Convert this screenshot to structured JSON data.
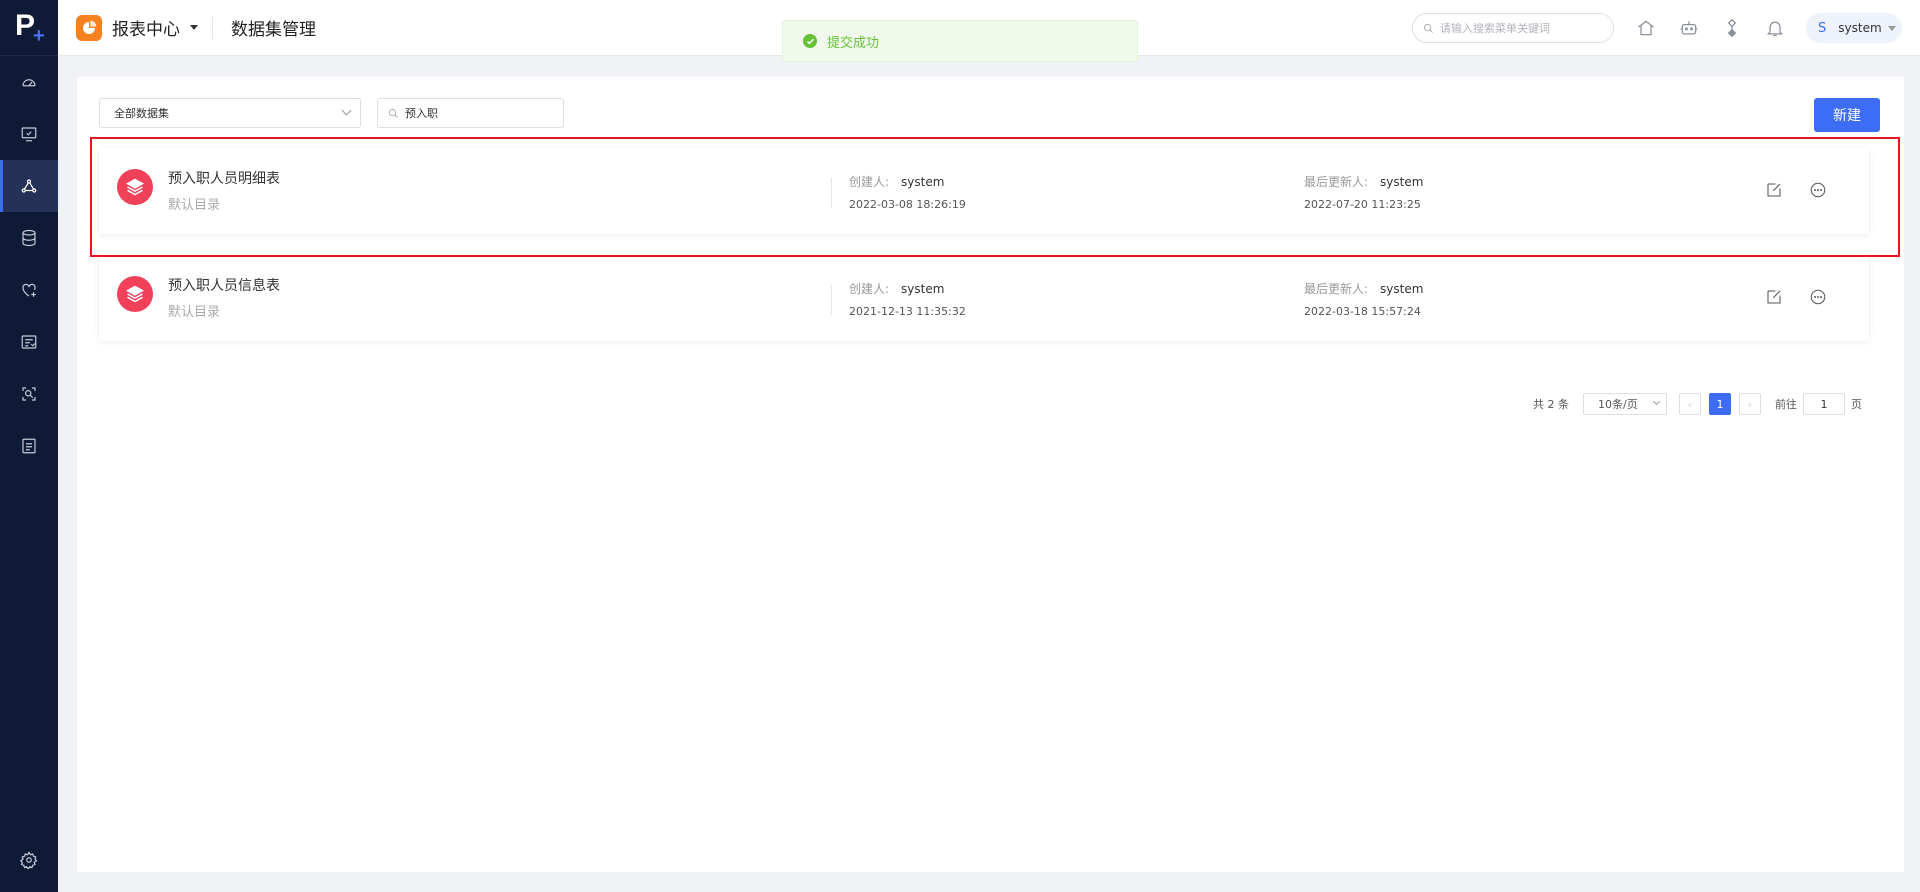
{
  "sidebar": {
    "logo": "P+",
    "items": [
      {
        "name": "dashboard-icon"
      },
      {
        "name": "monitor-icon"
      },
      {
        "name": "dataset-node-icon",
        "active": true
      },
      {
        "name": "database-icon"
      },
      {
        "name": "heart-plus-icon"
      },
      {
        "name": "report-list-icon"
      },
      {
        "name": "search-inspect-icon"
      },
      {
        "name": "form-icon"
      }
    ],
    "bottom": {
      "name": "settings-icon"
    }
  },
  "header": {
    "app_title": "报表中心",
    "page_title": "数据集管理",
    "search_placeholder": "请输入搜索菜单关键词",
    "user_initial": "S",
    "user_name": "system"
  },
  "toast": {
    "text": "提交成功",
    "status_color": "#67c23a"
  },
  "filters": {
    "select_value": "全部数据集",
    "search_value": "预入职",
    "new_button": "新建"
  },
  "datasets": [
    {
      "name": "预入职人员明细表",
      "directory": "默认目录",
      "creator_label": "创建人:",
      "creator": "system",
      "created_at": "2022-03-08 18:26:19",
      "updater_label": "最后更新人:",
      "updater": "system",
      "updated_at": "2022-07-20 11:23:25"
    },
    {
      "name": "预入职人员信息表",
      "directory": "默认目录",
      "creator_label": "创建人:",
      "creator": "system",
      "created_at": "2021-12-13 11:35:32",
      "updater_label": "最后更新人:",
      "updater": "system",
      "updated_at": "2022-03-18 15:57:24"
    }
  ],
  "pagination": {
    "total": "共 2 条",
    "page_size": "10条/页",
    "current_page": "1",
    "goto_label": "前往",
    "goto_value": "1",
    "page_unit": "页"
  },
  "colors": {
    "accent": "#3d6cf5",
    "sidebar_bg": "#0f1a36",
    "dataset_icon": "#f0405a",
    "highlight": "#e8141e",
    "app_badge": "#f5821f"
  }
}
